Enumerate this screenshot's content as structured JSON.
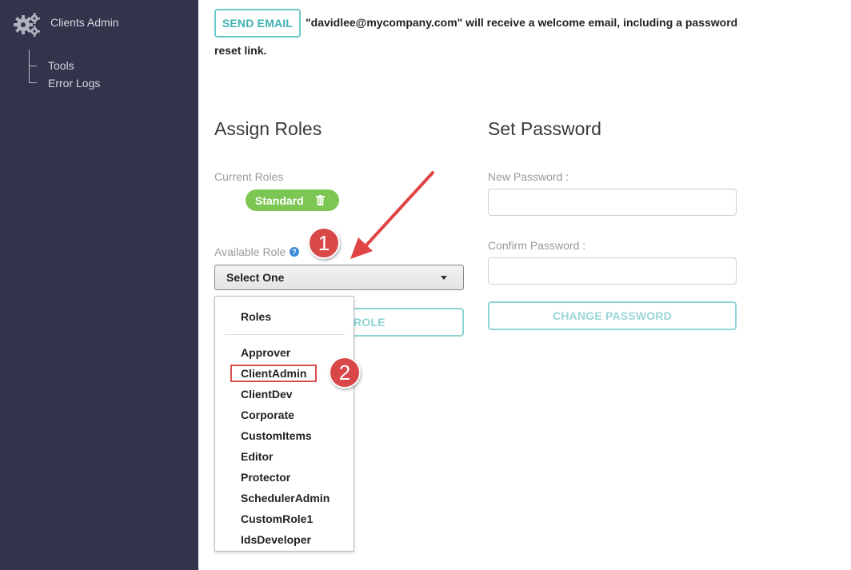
{
  "sidebar": {
    "brand_label": "Clients Admin",
    "items": [
      {
        "label": "Tools"
      },
      {
        "label": "Error Logs"
      }
    ]
  },
  "email": {
    "button_label": "SEND EMAIL",
    "message_line1": "\"davidlee@mycompany.com\" will receive a welcome email, including a password",
    "message_line2": "reset link."
  },
  "assign_roles": {
    "title": "Assign Roles",
    "current_roles_label": "Current Roles",
    "current_roles": [
      "Standard"
    ],
    "available_role_label": "Available Role",
    "select_value": "Select One",
    "add_role_label": "ROLE",
    "dropdown": {
      "header": "Roles",
      "options": [
        "Approver",
        "ClientAdmin",
        "ClientDev",
        "Corporate",
        "CustomItems",
        "Editor",
        "Protector",
        "SchedulerAdmin",
        "CustomRole1",
        "IdsDeveloper"
      ],
      "highlighted": "ClientAdmin"
    }
  },
  "set_password": {
    "title": "Set Password",
    "new_password_label": "New Password :",
    "new_password_value": "",
    "confirm_password_label": "Confirm Password :",
    "confirm_password_value": "",
    "change_button_label": "CHANGE PASSWORD"
  },
  "annotations": {
    "step1": "1",
    "step2": "2",
    "color": "#d94848"
  },
  "colors": {
    "sidebar_bg": "#33344b",
    "accent_teal": "#3fb0b0",
    "role_pill": "#7cc653"
  }
}
